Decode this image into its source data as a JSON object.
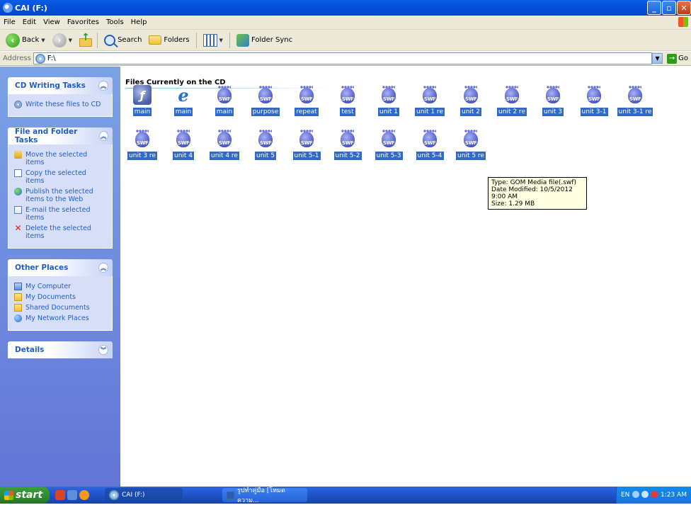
{
  "window": {
    "title": "CAI (F:)"
  },
  "menu": [
    "File",
    "Edit",
    "View",
    "Favorites",
    "Tools",
    "Help"
  ],
  "toolbar": {
    "back": "Back",
    "search": "Search",
    "folders": "Folders",
    "folder_sync": "Folder Sync"
  },
  "address": {
    "label": "Address",
    "value": "F:\\",
    "go": "Go"
  },
  "taskpane": {
    "cd_writing": {
      "title": "CD Writing Tasks",
      "items": [
        "Write these files to CD"
      ]
    },
    "file_folder": {
      "title": "File and Folder Tasks",
      "items": [
        "Move the selected items",
        "Copy the selected items",
        "Publish the selected items to the Web",
        "E-mail the selected items",
        "Delete the selected items"
      ]
    },
    "other_places": {
      "title": "Other Places",
      "items": [
        "My Computer",
        "My Documents",
        "Shared Documents",
        "My Network Places"
      ]
    },
    "details": {
      "title": "Details"
    }
  },
  "content": {
    "group_title": "Files Currently on the CD",
    "files": [
      {
        "name": "main",
        "type": "flash"
      },
      {
        "name": "main",
        "type": "ie"
      },
      {
        "name": "main",
        "type": "swf"
      },
      {
        "name": "purpose",
        "type": "swf"
      },
      {
        "name": "repeat",
        "type": "swf"
      },
      {
        "name": "test",
        "type": "swf"
      },
      {
        "name": "unit 1",
        "type": "swf"
      },
      {
        "name": "unit 1 re",
        "type": "swf"
      },
      {
        "name": "unit 2",
        "type": "swf"
      },
      {
        "name": "unit 2 re",
        "type": "swf"
      },
      {
        "name": "unit 3",
        "type": "swf"
      },
      {
        "name": "unit 3-1",
        "type": "swf"
      },
      {
        "name": "unit 3-1 re",
        "type": "swf"
      },
      {
        "name": "unit 3 re",
        "type": "swf"
      },
      {
        "name": "unit 4",
        "type": "swf"
      },
      {
        "name": "unit 4 re",
        "type": "swf"
      },
      {
        "name": "unit 5",
        "type": "swf"
      },
      {
        "name": "unit 5-1",
        "type": "swf"
      },
      {
        "name": "unit 5-2",
        "type": "swf"
      },
      {
        "name": "unit 5-3",
        "type": "swf"
      },
      {
        "name": "unit 5-4",
        "type": "swf"
      },
      {
        "name": "unit 5 re",
        "type": "swf"
      }
    ],
    "swf_label": "SWF",
    "tooltip": {
      "type": "Type: GOM Media file(.swf)",
      "modified": "Date Modified: 10/5/2012 9:00 AM",
      "size": "Size: 1.29 MB"
    }
  },
  "taskbar": {
    "start": "start",
    "buttons": [
      "CAI (F:)",
      "รูปทำคู่มือ [โหมดความ..."
    ],
    "lang": "EN",
    "clock": "1:23 AM"
  },
  "colors": {
    "selection": "#316ac5",
    "taskpane_link": "#215dc6",
    "titlebar": "#0450d8"
  }
}
